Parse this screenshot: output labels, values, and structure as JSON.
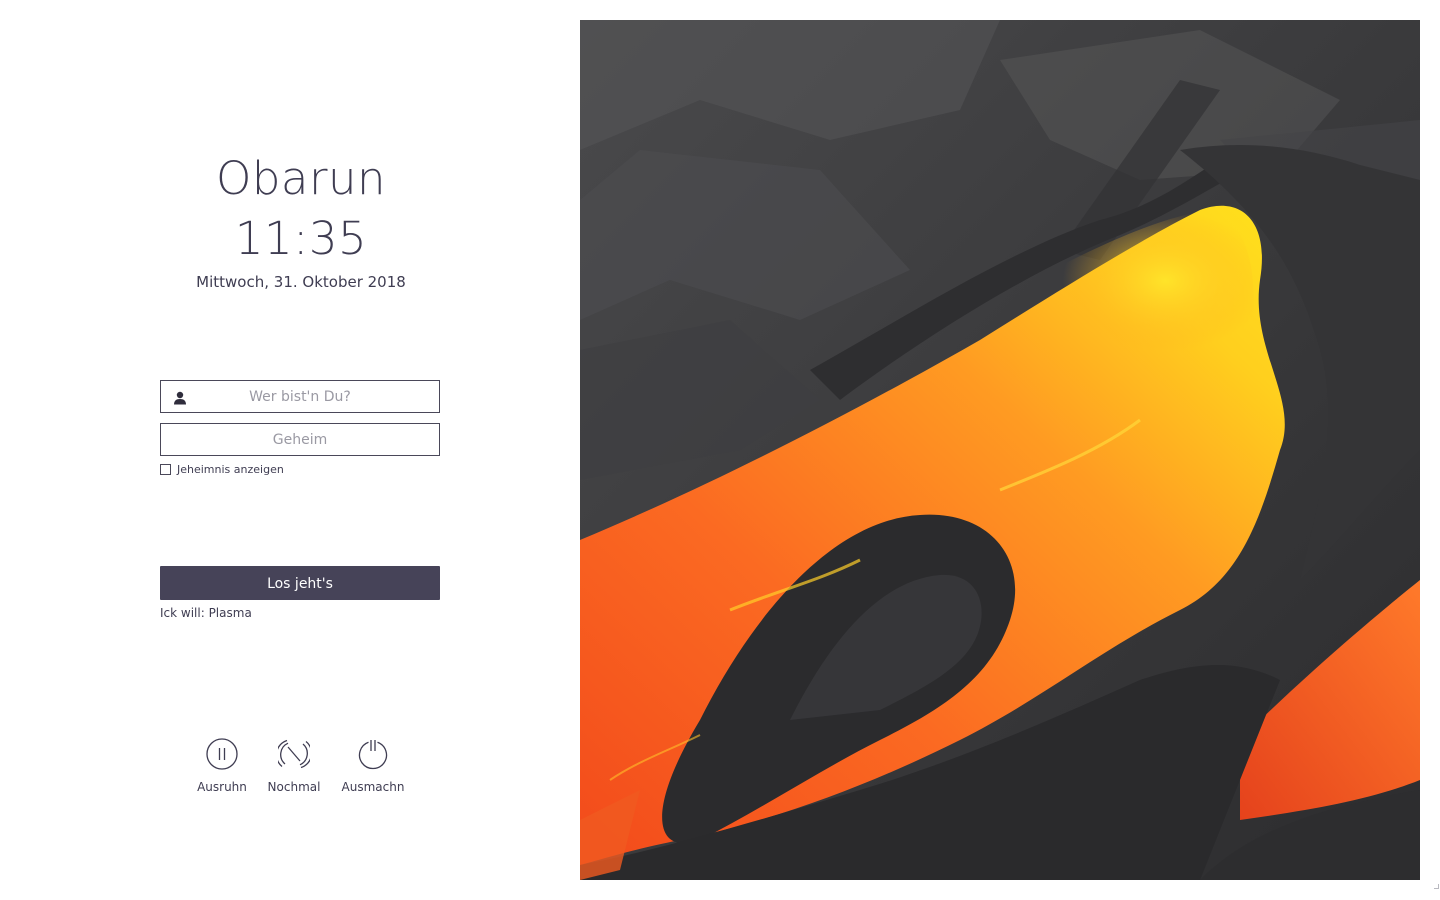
{
  "greeter": {
    "hostname": "Obarun",
    "time": "11:35",
    "date": "Mittwoch, 31. Oktober 2018"
  },
  "login": {
    "username_placeholder": "Wer bist'n Du?",
    "username_value": "",
    "password_placeholder": "Geheim",
    "password_value": "",
    "show_password_label": "Jeheimnis anzeigen",
    "show_password_checked": false,
    "submit_label": "Los jeht's",
    "session_label": "Ick will: Plasma"
  },
  "power": {
    "suspend_label": "Ausruhn",
    "reboot_label": "Nochmal",
    "shutdown_label": "Ausmachn"
  },
  "icons": {
    "user": "user-icon",
    "suspend": "pause-icon",
    "reboot": "restart-icon",
    "shutdown": "power-icon"
  },
  "colors": {
    "accent": "#464358",
    "text": "#3f3d52",
    "background": "#ffffff"
  }
}
